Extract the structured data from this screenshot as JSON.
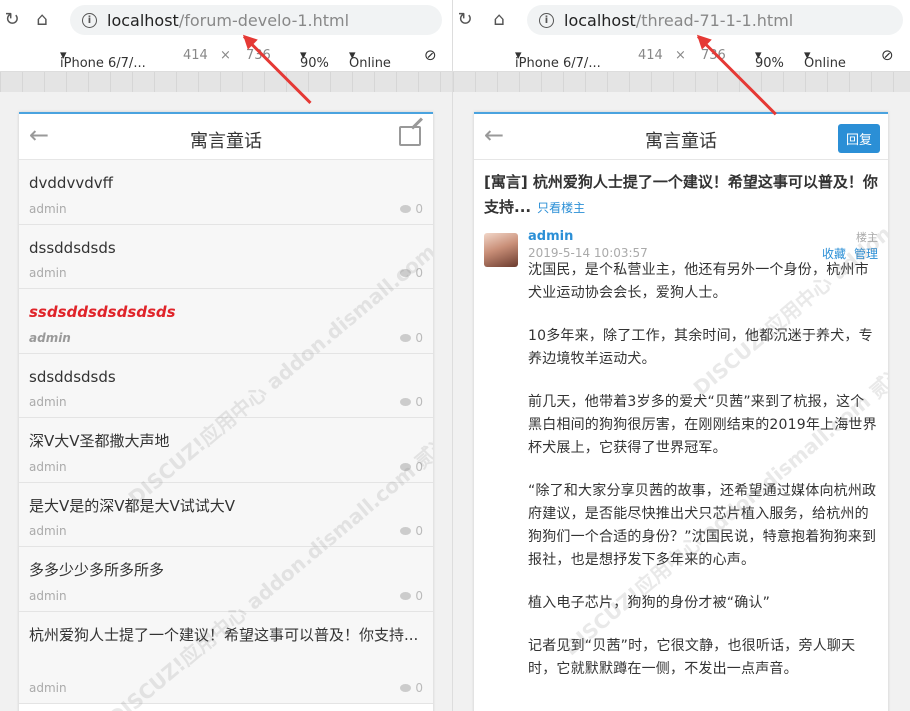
{
  "left": {
    "url_host": "localhost",
    "url_path": "/forum-develo-1.html",
    "device": "iPhone 6/7/...",
    "width": "414",
    "times": "×",
    "height": "736",
    "zoom": "90%",
    "network": "Online",
    "header_title": "寓言童话",
    "threads": [
      {
        "title": "dvddvvdvff",
        "author": "admin",
        "replies": "0"
      },
      {
        "title": "dssddsdsds",
        "author": "admin",
        "replies": "0"
      },
      {
        "title": "ssdsddsdsdsdsds",
        "author": "admin",
        "replies": "0"
      },
      {
        "title": "sdsddsdsds",
        "author": "admin",
        "replies": "0"
      },
      {
        "title": "深V大V圣都撒大声地",
        "author": "admin",
        "replies": "0"
      },
      {
        "title": "是大V是的深V都是大V试试大V",
        "author": "admin",
        "replies": "0"
      },
      {
        "title": "多多少少多所多所多",
        "author": "admin",
        "replies": "0"
      },
      {
        "title": "杭州爱狗人士提了一个建议！希望这事可以普及！你支持...",
        "author": "admin",
        "replies": "0"
      }
    ]
  },
  "right": {
    "url_host": "localhost",
    "url_path": "/thread-71-1-1.html",
    "device": "iPhone 6/7/...",
    "width": "414",
    "times": "×",
    "height": "736",
    "zoom": "90%",
    "network": "Online",
    "header_title": "寓言童话",
    "reply_label": "回复",
    "post_title": "[寓言] 杭州爱狗人士提了一个建议！希望这事可以普及！你支持...",
    "only_op": "只看楼主",
    "author": "admin",
    "time": "2019-5-14 10:03:57",
    "floor": "楼主",
    "favorite": "收藏",
    "manage": "管理",
    "paragraphs": [
      "沈国民，是个私营业主，他还有另外一个身份，杭州市犬业运动协会会长，爱狗人士。",
      "10多年来，除了工作，其余时间，他都沉迷于养犬，专养边境牧羊运动犬。",
      "前几天，他带着3岁多的爱犬“贝茜”来到了杭报，这个黑白相间的狗狗很厉害，在刚刚结束的2019年上海世界杯犬展上，它获得了世界冠军。",
      "“除了和大家分享贝茜的故事，还希望通过媒体向杭州政府建议，是否能尽快推出犬只芯片植入服务，给杭州的狗狗们一个合适的身份？”沈国民说，特意抱着狗狗来到报社，也是想抒发下多年来的心声。",
      "植入电子芯片，狗狗的身份才被“确认”",
      "记者见到“贝茜”时，它很文静，也很听话，旁人聊天时，它就默默蹲在一侧，不发出一点声音。"
    ]
  },
  "watermark": "DISCUZ!应用中心 addon.dismall.com 贰道",
  "colors": {
    "accent": "#2b8fd6",
    "highlight": "#e0242a",
    "arrow": "#e53935"
  }
}
